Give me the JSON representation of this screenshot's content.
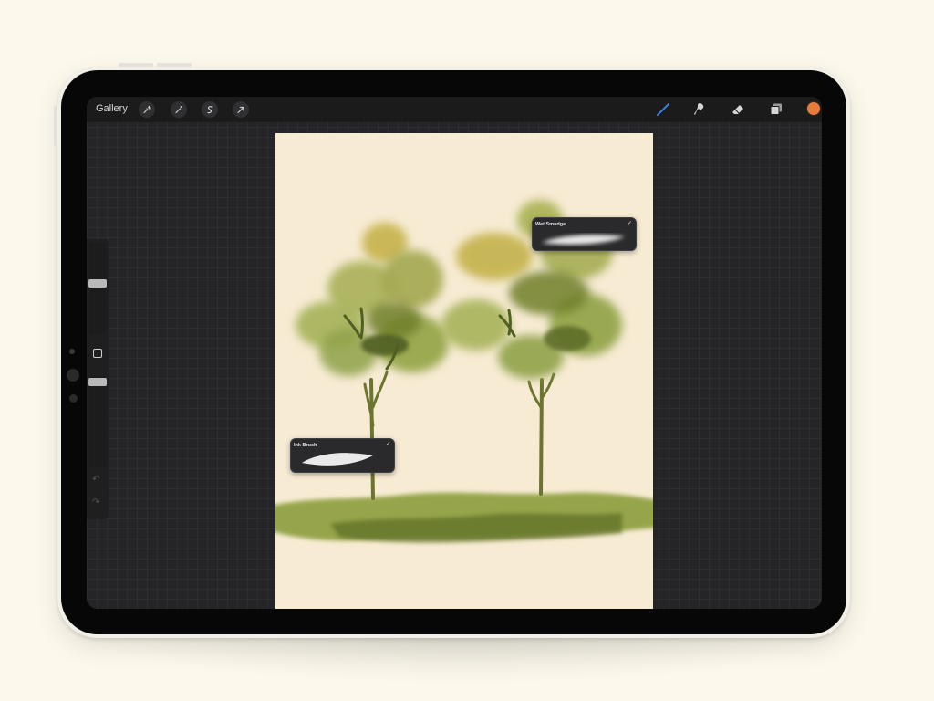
{
  "toolbar": {
    "gallery_label": "Gallery",
    "left_tools": [
      "wrench-icon",
      "magic-wand-icon",
      "selection-icon",
      "transform-arrow-icon"
    ],
    "right_tools": [
      "brush-icon",
      "smudge-icon",
      "eraser-icon",
      "layers-icon"
    ],
    "active_tool": "brush-icon",
    "color": "#e87a3a"
  },
  "sidebar": {
    "size_slider": 0.45,
    "opacity_slider": 0.0,
    "modify_button": "square-icon",
    "undo": "undo-arrow-icon",
    "redo": "redo-arrow-icon"
  },
  "brush_labels": {
    "wet": {
      "name": "Wet Smudge",
      "check": "✓"
    },
    "ink": {
      "name": "Ink Brush",
      "check": "✓"
    }
  },
  "colors": {
    "background": "#fcf8ec",
    "screen": "#252527",
    "canvas": "#f7ebd3",
    "accent": "#3a7cd8",
    "foliage_light": "#9bab4f",
    "foliage_dark": "#4f5f22",
    "foliage_yellow": "#c1b24a"
  }
}
